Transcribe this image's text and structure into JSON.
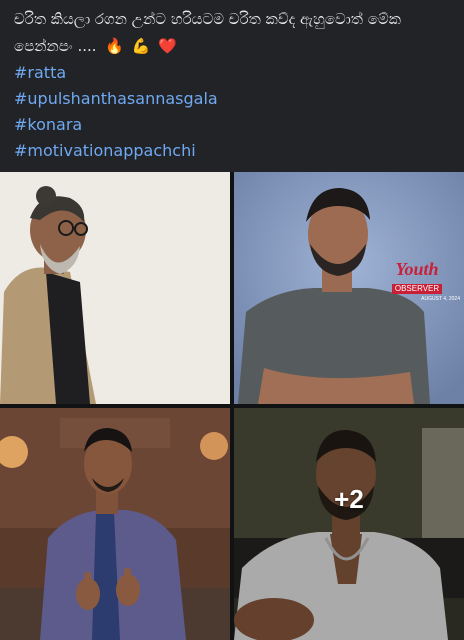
{
  "post": {
    "text_line_1": "චරිත කියලා රගන උන්ට හරියටම චරිත කව්ද ඇහුවොත් මේක",
    "text_line_2": "පෙන්නපං ....",
    "emojis": [
      {
        "name": "fire-icon",
        "glyph": "🔥"
      },
      {
        "name": "flexed-biceps-icon",
        "glyph": "💪"
      },
      {
        "name": "red-heart-icon",
        "glyph": "❤️"
      }
    ],
    "hashtags": [
      {
        "name": "hashtag-ratta",
        "label": "#ratta"
      },
      {
        "name": "hashtag-upulshanthasannasgala",
        "label": "#upulshanthasannasgala"
      },
      {
        "name": "hashtag-konara",
        "label": "#konara"
      },
      {
        "name": "hashtag-motivationappachchi",
        "label": "#motivationappachchi"
      }
    ]
  },
  "photos": {
    "watermark_line_1": "Youth",
    "watermark_line_2": "OBSERVER",
    "watermark_date": "AUGUST 4, 2024",
    "more_count": "+2"
  },
  "colors": {
    "background": "#222326",
    "text": "#e7e8ea",
    "hashtag": "#6fa9f2"
  }
}
